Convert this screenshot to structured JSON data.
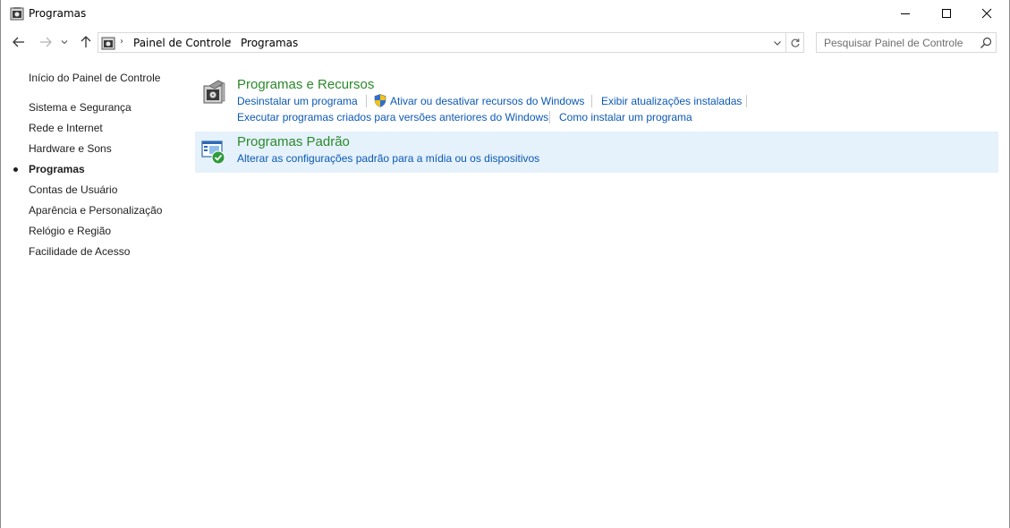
{
  "window": {
    "title": "Programas",
    "minimize_icon": "minimize-icon",
    "maximize_icon": "maximize-icon",
    "close_icon": "close-icon"
  },
  "address_bar": {
    "breadcrumbs": [
      "Painel de Controle",
      "Programas"
    ],
    "search_placeholder": "Pesquisar Painel de Controle"
  },
  "sidebar": {
    "home_link": "Início do Painel de Controle",
    "items": [
      {
        "label": "Sistema e Segurança",
        "active": false
      },
      {
        "label": "Rede e Internet",
        "active": false
      },
      {
        "label": "Hardware e Sons",
        "active": false
      },
      {
        "label": "Programas",
        "active": true
      },
      {
        "label": "Contas de Usuário",
        "active": false
      },
      {
        "label": "Aparência e Personalização",
        "active": false
      },
      {
        "label": "Relógio e Região",
        "active": false
      },
      {
        "label": "Facilidade de Acesso",
        "active": false
      }
    ]
  },
  "categories": [
    {
      "title": "Programas e Recursos",
      "icon": "programs-features-icon",
      "links": [
        "Desinstalar um programa",
        "Ativar ou desativar recursos do Windows",
        "Exibir atualizações instaladas",
        "Executar programas criados para versões anteriores do Windows",
        "Como instalar um programa"
      ]
    },
    {
      "title": "Programas Padrão",
      "icon": "default-programs-icon",
      "links": [
        "Alterar as configurações padrão para a mídia ou os dispositivos"
      ]
    }
  ],
  "colors": {
    "category_title": "#2a8a2a",
    "link": "#0b59b5",
    "hover_background": "#e5f1fb"
  }
}
